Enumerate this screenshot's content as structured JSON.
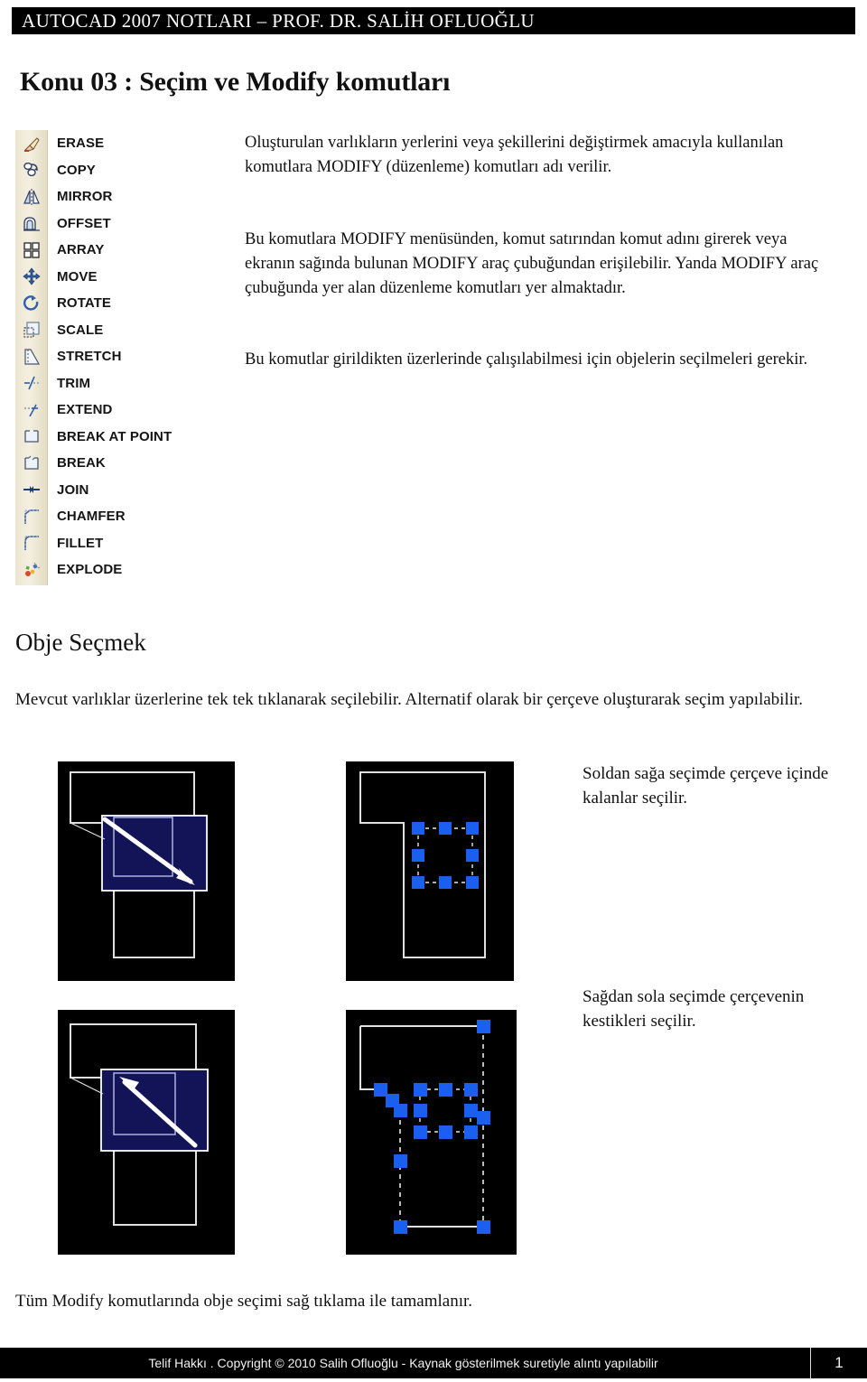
{
  "header": {
    "title": "AUTOCAD 2007 NOTLARI – PROF. DR. SALİH OFLUOĞLU"
  },
  "page_title": "Konu 03 : Seçim ve Modify komutları",
  "toolbar": {
    "name": "MODIFY",
    "items": [
      {
        "icon": "erase-icon",
        "label": "ERASE"
      },
      {
        "icon": "copy-icon",
        "label": "COPY"
      },
      {
        "icon": "mirror-icon",
        "label": "MIRROR"
      },
      {
        "icon": "offset-icon",
        "label": "OFFSET"
      },
      {
        "icon": "array-icon",
        "label": "ARRAY"
      },
      {
        "icon": "move-icon",
        "label": "MOVE"
      },
      {
        "icon": "rotate-icon",
        "label": "ROTATE"
      },
      {
        "icon": "scale-icon",
        "label": "SCALE"
      },
      {
        "icon": "stretch-icon",
        "label": "STRETCH"
      },
      {
        "icon": "trim-icon",
        "label": "TRIM"
      },
      {
        "icon": "extend-icon",
        "label": "EXTEND"
      },
      {
        "icon": "break-at-point-icon",
        "label": "BREAK AT POINT"
      },
      {
        "icon": "break-icon",
        "label": "BREAK"
      },
      {
        "icon": "join-icon",
        "label": "JOIN"
      },
      {
        "icon": "chamfer-icon",
        "label": "CHAMFER"
      },
      {
        "icon": "fillet-icon",
        "label": "FILLET"
      },
      {
        "icon": "explode-icon",
        "label": "EXPLODE"
      }
    ]
  },
  "body": {
    "p1": "Oluşturulan varlıkların yerlerini veya şekillerini değiştirmek amacıyla kullanılan komutlara MODIFY (düzenleme) komutları adı verilir.",
    "p2": "Bu komutlara MODIFY menüsünden, komut satırından komut adını girerek veya ekranın sağında bulunan MODIFY araç çubuğundan erişilebilir. Yanda MODIFY araç çubuğunda yer alan düzenleme komutları yer almaktadır.",
    "p3": "Bu komutlar girildikten üzerlerinde çalışılabilmesi için objelerin seçilmeleri gerekir."
  },
  "section": {
    "heading": "Obje Seçmek",
    "paragraph": "Mevcut varlıklar üzerlerine tek tek tıklanarak seçilebilir. Alternatif olarak bir çerçeve oluşturarak seçim yapılabilir."
  },
  "figures": {
    "caption_left_to_right": "Soldan sağa seçimde çerçeve içinde kalanlar seçilir.",
    "caption_right_to_left": "Sağdan sola seçimde çerçevenin kestikleri seçilir.",
    "canvas_color": "#000000",
    "entity_color": "#e8e8e8",
    "selection_window_color": "#131357",
    "grip_color": "#1a5ff0",
    "cursor_color": "#ffffff"
  },
  "closing_note": "Tüm Modify komutlarında obje seçimi sağ tıklama ile tamamlanır.",
  "footer": {
    "copyright": "Telif Hakkı . Copyright © 2010 Salih Ofluoğlu - Kaynak gösterilmek suretiyle alıntı yapılabilir",
    "page_number": "1"
  }
}
